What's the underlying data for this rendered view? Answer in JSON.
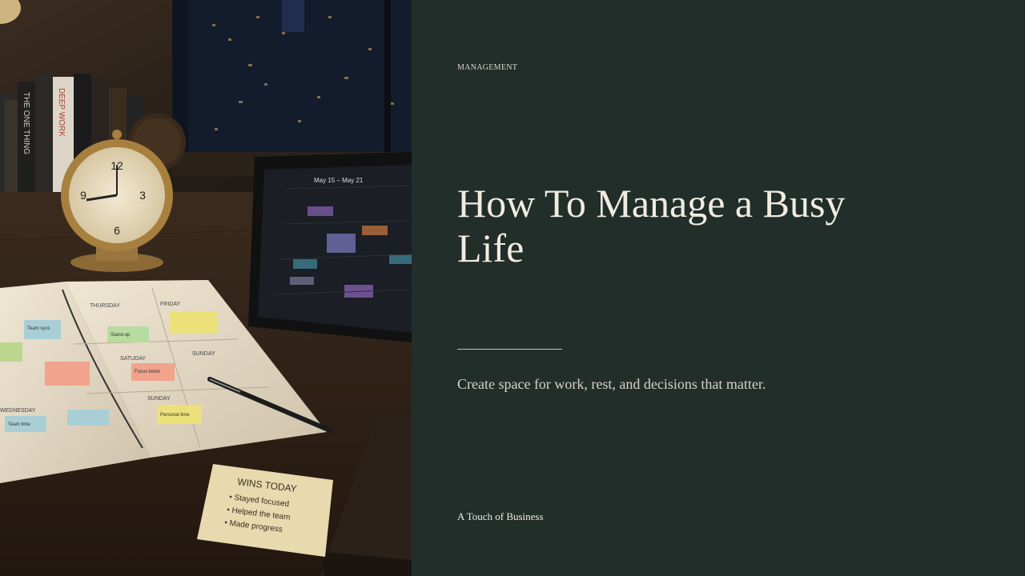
{
  "slide": {
    "eyebrow": "MANAGEMENT",
    "title": "How To Manage a Busy Life",
    "subtitle": "Create space for work, rest, and decisions that matter.",
    "brand": "A Touch of Business"
  },
  "photo": {
    "tablet_header": "May 15 – May 21",
    "planner": {
      "thursday": "THURSDAY",
      "friday": "FRIDAY",
      "saturday": "SATUDAY",
      "sunday_top": "SUNDAY",
      "sunday": "SUNDAY",
      "wednesday": "WEDNESDAY",
      "note_team_sync": "Team sync",
      "note_team_time": "Team time",
      "note_stand_up": "Stand-up",
      "note_focus": "Focus block",
      "note_personal": "Personal time"
    },
    "sticky_note": {
      "heading": "WINS TODAY",
      "lines": [
        "• Stayed focused",
        "• Helped the team",
        "• Made progress"
      ]
    },
    "book_spines": [
      "THE ONE THING",
      "DEEP WORK"
    ]
  },
  "colors": {
    "panel_bg": "#212e2a",
    "title": "#f1ece1",
    "text": "#d7d3c8"
  }
}
